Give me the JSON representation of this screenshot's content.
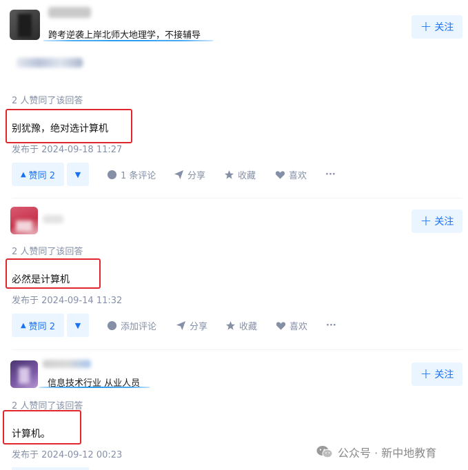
{
  "colors": {
    "accent": "#1772f6",
    "accent_bg": "#ebf5ff",
    "muted": "#8590a6",
    "highlight_box": "#e0262a",
    "underline": "#2d9bf0"
  },
  "answers": [
    {
      "headline": "跨考逆袭上岸北师大地理学，不接辅导",
      "follow_label": "关注",
      "vote_summary": "2 人赞同了该回答",
      "content": "别犹豫，绝对选计算机",
      "published": "发布于 2024-09-18 11:27",
      "upvote_label": "赞同 2",
      "comment_label": "1 条评论",
      "share_label": "分享",
      "collect_label": "收藏",
      "like_label": "喜欢",
      "more_label": "···"
    },
    {
      "headline": "",
      "follow_label": "关注",
      "vote_summary": "2 人赞同了该回答",
      "content": "必然是计算机",
      "published": "发布于 2024-09-14 11:32",
      "upvote_label": "赞同 2",
      "comment_label": "添加评论",
      "share_label": "分享",
      "collect_label": "收藏",
      "like_label": "喜欢",
      "more_label": "···"
    },
    {
      "headline": "信息技术行业 从业人员",
      "follow_label": "关注",
      "vote_summary": "2 人赞同了该回答",
      "content": "计算机。",
      "published": "发布于 2024-09-12 00:23"
    }
  ],
  "watermark": {
    "text": "公众号 · 新中地教育",
    "icon": "wechat-icon"
  }
}
